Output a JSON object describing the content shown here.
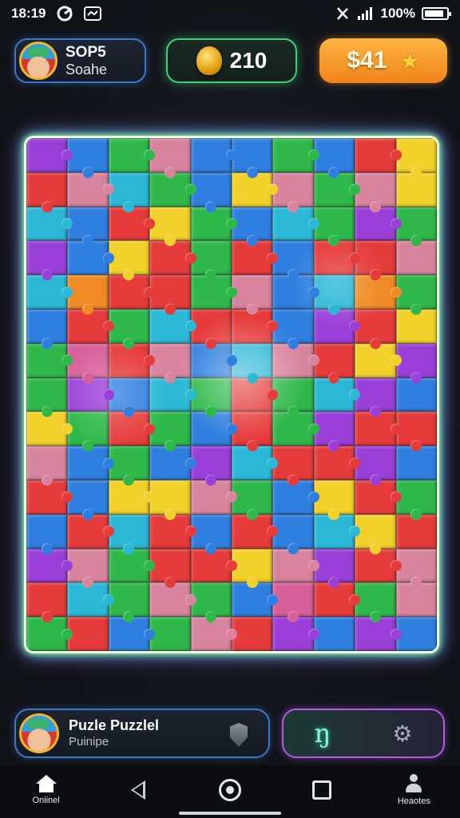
{
  "status_bar": {
    "time": "18:19",
    "battery": "100%",
    "battery_level": 0.9,
    "icons": [
      "app-notification-icon",
      "message-icon",
      "vibrate-icon",
      "signal-icon",
      "battery-icon"
    ]
  },
  "profile": {
    "name": "SOP5",
    "subtitle": "Soahe"
  },
  "currency": {
    "coins": "210",
    "cash": "$41"
  },
  "board": {
    "columns": 10,
    "rows": 15,
    "palette": {
      "R": "#e63b3b",
      "G": "#2fb84a",
      "B": "#2f7fe0",
      "Y": "#f2d12a",
      "P": "#9a3fd8",
      "K": "#d9849e",
      "O": "#f08a24",
      "C": "#2bb8d6",
      "M": "#d8609a",
      "L": "#6fd05a"
    },
    "pieces": [
      "PBGKBBGBRY",
      "RKCGBYKGKY",
      "CBRYGBCGPG",
      "PBYRGRBRRK",
      "CORRGKBCOG",
      "BRGCRRBPRY",
      "GMRKBCKRYP",
      "GPBCGRGCPB",
      "YGRGBRGPRR",
      "KBGBPCRRPB",
      "RBYYKGBYRG",
      "BRCRBRBCYR",
      "PKGRRYKPRK",
      "RCGKGBMRGK",
      "GRBGKRPBPB"
    ]
  },
  "bottom": {
    "title": "Puzle Puzzlel",
    "subtitle": "Puinipe",
    "action_glyph": "ŋ"
  },
  "nav": {
    "home_label": "Oniinel",
    "profile_label": "Heaotes"
  }
}
